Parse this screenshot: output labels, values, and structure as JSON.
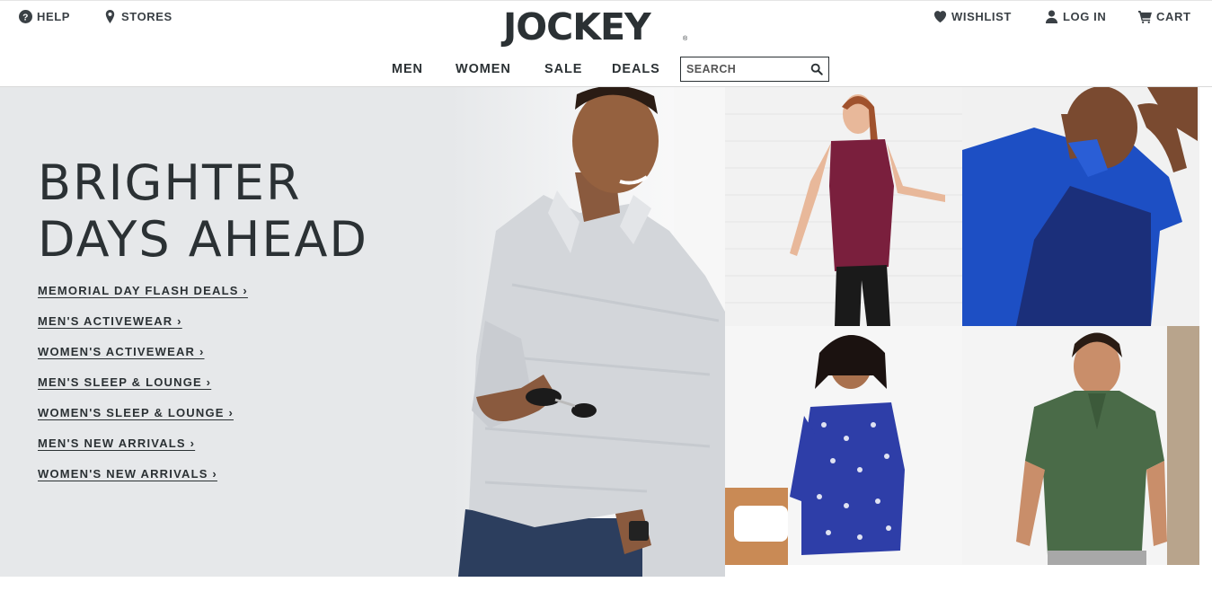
{
  "header": {
    "help_label": "HELP",
    "stores_label": "STORES",
    "logo_text": "JOCKEY",
    "logo_mark": "®",
    "wishlist_label": "WISHLIST",
    "login_label": "LOG IN",
    "cart_label": "CART"
  },
  "nav": {
    "items": [
      "MEN",
      "WOMEN",
      "SALE",
      "DEALS"
    ]
  },
  "search": {
    "placeholder": "SEARCH"
  },
  "hero": {
    "title": "BRIGHTER\nDAYS AHEAD",
    "links": [
      "MEMORIAL DAY FLASH DEALS ›",
      "MEN'S ACTIVEWEAR ›",
      "WOMEN'S ACTIVEWEAR ›",
      "MEN'S SLEEP & LOUNGE ›",
      "WOMEN'S SLEEP & LOUNGE ›",
      "MEN'S NEW ARRIVALS ›",
      "WOMEN'S NEW ARRIVALS ›"
    ]
  },
  "colors": {
    "text": "#2b3134",
    "hero_background": "#e6e8ea",
    "maroon_tee": "#7a1f3d",
    "blue_polo": "#1d4fc4",
    "navy_polo": "#1b2f7a",
    "blue_print_dress": "#2e3ea8",
    "green_henley": "#4a6b48",
    "gray_polo": "#d3d6da"
  },
  "icons": {
    "help": "question-circle-icon",
    "stores": "map-pin-icon",
    "wishlist": "heart-icon",
    "login": "user-icon",
    "cart": "cart-icon",
    "search": "search-icon"
  }
}
